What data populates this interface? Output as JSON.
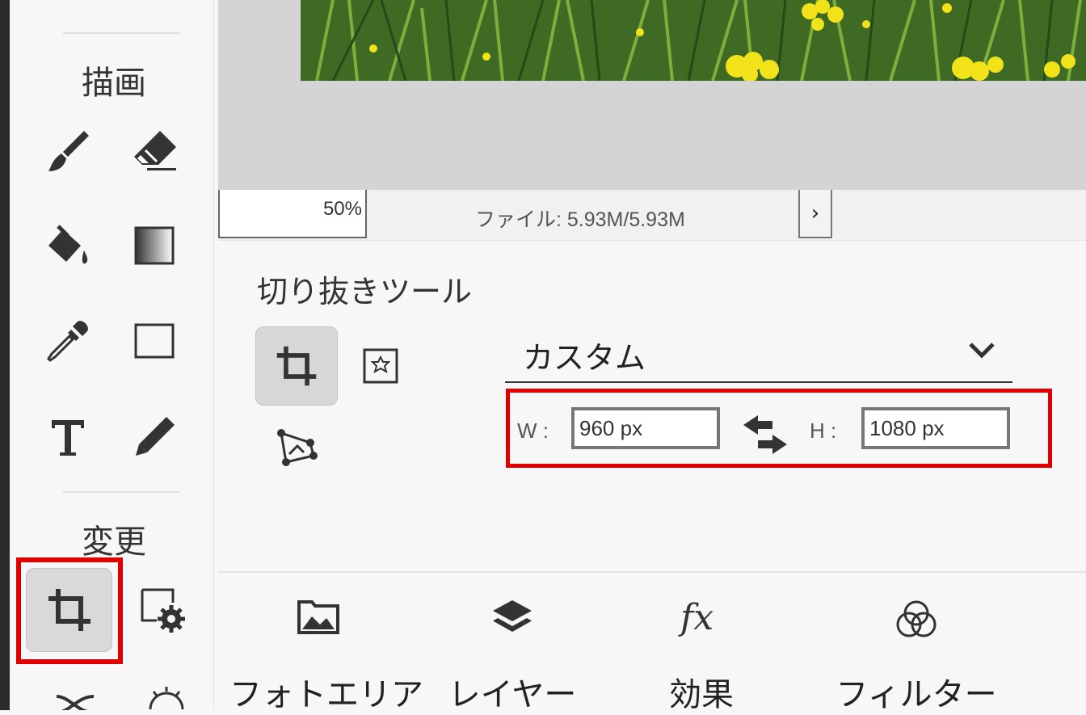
{
  "left_toolbar": {
    "section_draw": "描画",
    "section_transform": "変更",
    "draw_tools": [
      {
        "name": "brush-tool",
        "icon": "brush-icon"
      },
      {
        "name": "eraser-tool",
        "icon": "eraser-icon"
      },
      {
        "name": "fill-tool",
        "icon": "paint-bucket-icon"
      },
      {
        "name": "gradient-tool",
        "icon": "gradient-icon"
      },
      {
        "name": "eyedropper-tool",
        "icon": "eyedropper-icon"
      },
      {
        "name": "shape-tool",
        "icon": "rectangle-icon"
      },
      {
        "name": "text-tool",
        "icon": "text-icon"
      },
      {
        "name": "pencil-tool",
        "icon": "pencil-icon"
      }
    ],
    "transform_tools": [
      {
        "name": "crop-tool",
        "icon": "crop-icon",
        "active": true
      },
      {
        "name": "canvas-settings-tool",
        "icon": "canvas-settings-icon"
      }
    ]
  },
  "status_bar": {
    "zoom": "50%",
    "file_info": "ファイル: 5.93M/5.93M",
    "expand_glyph": "›"
  },
  "crop_panel": {
    "title": "切り抜きツール",
    "preset": {
      "selected": "カスタム"
    },
    "width_label": "W :",
    "width_value": "960 px",
    "height_label": "H :",
    "height_value": "1080 px"
  },
  "bottom_nav": [
    {
      "label": "フォトエリア",
      "icon": "photo-folder-icon"
    },
    {
      "label": "レイヤー",
      "icon": "layers-icon"
    },
    {
      "label": "効果",
      "icon": "fx-icon"
    },
    {
      "label": "フィルター",
      "icon": "filter-icon"
    }
  ],
  "colors": {
    "highlight_red": "#e00000",
    "active_button_bg": "#d7d7d7",
    "panel_bg": "#f7f7f7",
    "canvas_bg": "#d4d4d4"
  }
}
